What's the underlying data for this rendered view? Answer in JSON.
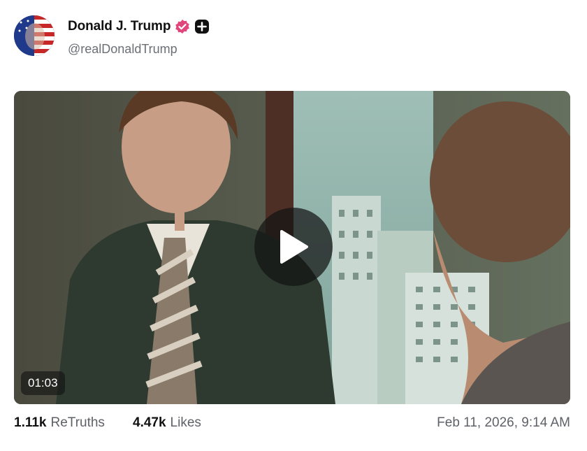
{
  "author": {
    "display_name": "Donald J. Trump",
    "handle": "@realDonaldTrump",
    "avatar_icon": "flag-portrait-avatar",
    "verified_icon": "verified-badge-icon",
    "extra_icon": "plus-badge-icon",
    "verified_color": "#e0457b"
  },
  "media": {
    "type": "video",
    "duration": "01:03",
    "play_icon": "play-icon"
  },
  "stats": {
    "retruths_count": "1.11k",
    "retruths_label": "ReTruths",
    "likes_count": "4.47k",
    "likes_label": "Likes"
  },
  "timestamp": "Feb 11, 2026, 9:14 AM"
}
